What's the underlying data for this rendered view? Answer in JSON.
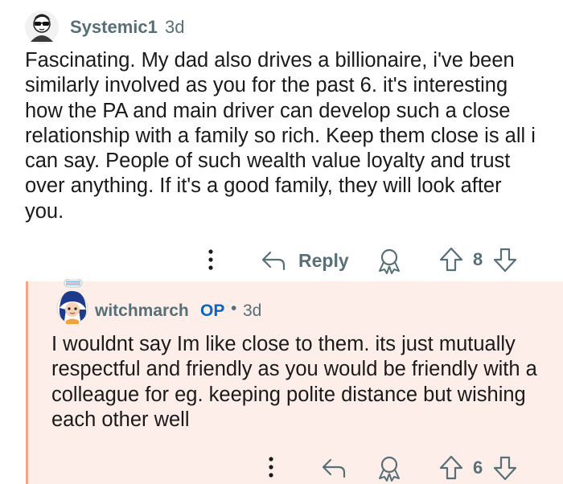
{
  "comment": {
    "author": "Systemic1",
    "time": "3d",
    "body": "Fascinating. My dad also drives a billionaire, i've been similarly involved as you for the past 6. it's interesting how the PA and main driver can develop such a close relationship with a family so rich. Keep them close is all i can say. People of such wealth value loyalty and trust over anything. If it's a good family, they will look after you.",
    "actions": {
      "reply_label": "Reply",
      "vote_count": "8"
    }
  },
  "reply": {
    "author": "witchmarch",
    "op_badge": "OP",
    "separator": "•",
    "time": "3d",
    "body": "I wouldnt say Im like close to them. its just mutually respectful and friendly as you would be friendly with a colleague for eg. keeping polite distance but wishing each other well",
    "actions": {
      "vote_count": "6"
    }
  },
  "colors": {
    "meta_text": "#576f76",
    "op_badge": "#0a66c2",
    "reply_background": "#fdeee9",
    "thread_line": "#f5a58a"
  },
  "icons": [
    "avatar",
    "more-icon",
    "reply-arrow-icon",
    "award-icon",
    "upvote-icon",
    "downvote-icon"
  ]
}
